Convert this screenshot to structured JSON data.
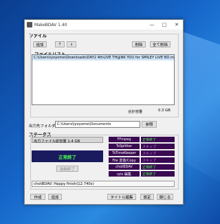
{
  "window": {
    "title": "MakeBDAV 1.40"
  },
  "file_group": {
    "label": "ファイル",
    "add_button": "追加",
    "up_button": "↑",
    "down_button": "↓",
    "delete_button": "削除",
    "delete_all_button": "全て削除",
    "list_label": "ファイルリスト",
    "files": [
      "C:\\Users\\iyoyome\\Downloads\\DAY2  4thLIVE TH@NK YOU for SMILEY LIVE BD.mp4"
    ],
    "total_label": "合計容量",
    "total_value": "0.3 GB"
  },
  "output": {
    "label": "出力先フォルダー",
    "path": "C:\\Users\\iyoyome\\Documents",
    "browse_button": "参照"
  },
  "status": {
    "label": "ステータス",
    "output_size_text": "出力ファイル総容量    1.4 GB",
    "done_text": "正常終了",
    "abort_button": "強制終了",
    "processes": [
      {
        "name": "FFmpeg",
        "state": "正常終了",
        "status": "ok"
      },
      {
        "name": "TsSplitter",
        "state": "スキップ",
        "status": "skip"
      },
      {
        "name": "TsTimeKeeper",
        "state": "スキップ",
        "status": "skip"
      },
      {
        "name": "File 変換/Copy",
        "state": "スキップ",
        "status": "skip"
      },
      {
        "name": "chotBDAV",
        "state": "正常終了",
        "status": "ok"
      },
      {
        "name": "rpls 編集",
        "state": "正常終了",
        "status": "ok"
      }
    ],
    "log": "chotBDAV: Happy finish(12.740s)"
  },
  "bottom": {
    "create_button": "作成",
    "add_button": "追加",
    "title_edit_button": "タイトル編集",
    "settings_button": "設定",
    "close_button": "閉じる"
  }
}
